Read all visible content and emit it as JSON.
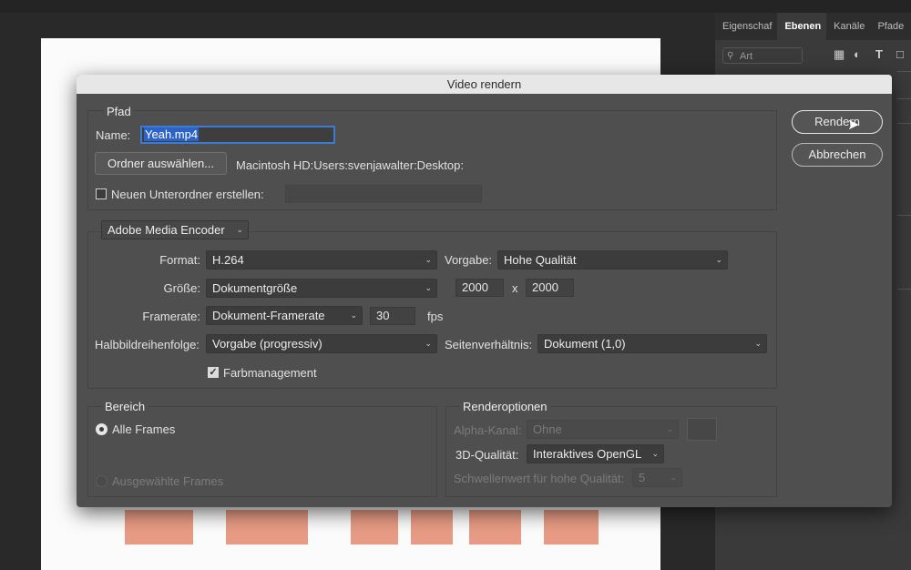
{
  "panel": {
    "tabs": [
      "Eigenschaf",
      "Ebenen",
      "Kanäle",
      "Pfade"
    ],
    "active_tab": "Ebenen",
    "search_value": "Art"
  },
  "dialog": {
    "title": "Video rendern",
    "path": {
      "section": "Pfad",
      "name_label": "Name:",
      "name_value": "Yeah.mp4",
      "folder_button": "Ordner auswählen...",
      "folder_path": "Macintosh HD:Users:svenjawalter:Desktop:",
      "subfolder_label": "Neuen Unterordner erstellen:",
      "subfolder_checked": false,
      "subfolder_value": ""
    },
    "encoder": {
      "selected": "Adobe Media Encoder",
      "format_label": "Format:",
      "format_value": "H.264",
      "preset_label": "Vorgabe:",
      "preset_value": "Hohe Qualität",
      "size_label": "Größe:",
      "size_value": "Dokumentgröße",
      "width": "2000",
      "times": "x",
      "height": "2000",
      "framerate_label": "Framerate:",
      "framerate_value": "Dokument-Framerate",
      "fps_value": "30",
      "fps_unit": "fps",
      "field_order_label": "Halbbildreihenfolge:",
      "field_order_value": "Vorgabe (progressiv)",
      "aspect_label": "Seitenverhältnis:",
      "aspect_value": "Dokument (1,0)",
      "color_mgmt_label": "Farbmanagement",
      "color_mgmt_checked": true
    },
    "range": {
      "section": "Bereich",
      "all_frames": "Alle Frames",
      "selected_frames": "Ausgewählte Frames"
    },
    "render_options": {
      "section": "Renderoptionen",
      "alpha_label": "Alpha-Kanal:",
      "alpha_value": "Ohne",
      "quality_label": "3D-Qualität:",
      "quality_value": "Interaktives OpenGL",
      "threshold_label": "Schwellenwert für hohe Qualität:",
      "threshold_value": "5"
    },
    "buttons": {
      "render": "Rendern",
      "cancel": "Abbrechen"
    }
  }
}
